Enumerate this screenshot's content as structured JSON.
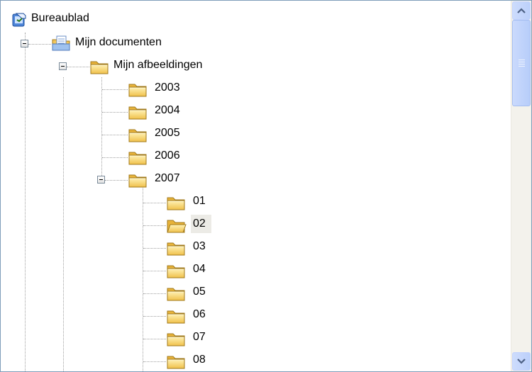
{
  "tree": {
    "root": {
      "label": "Bureaublad",
      "icon": "desktop-icon"
    },
    "documents": {
      "label": "Mijn documenten",
      "icon": "my-documents-icon",
      "expanded": true
    },
    "pictures": {
      "label": "Mijn afbeeldingen",
      "icon": "folder-icon",
      "expanded": true
    },
    "years": [
      {
        "label": "2003",
        "icon": "folder-icon"
      },
      {
        "label": "2004",
        "icon": "folder-icon"
      },
      {
        "label": "2005",
        "icon": "folder-icon"
      },
      {
        "label": "2006",
        "icon": "folder-icon"
      },
      {
        "label": "2007",
        "icon": "folder-icon",
        "expanded": true
      }
    ],
    "months": [
      {
        "label": "01",
        "icon": "folder-icon"
      },
      {
        "label": "02",
        "icon": "open-folder-icon",
        "selected": true
      },
      {
        "label": "03",
        "icon": "folder-icon"
      },
      {
        "label": "04",
        "icon": "folder-icon"
      },
      {
        "label": "05",
        "icon": "folder-icon"
      },
      {
        "label": "06",
        "icon": "folder-icon"
      },
      {
        "label": "07",
        "icon": "folder-icon"
      },
      {
        "label": "08",
        "icon": "folder-icon"
      }
    ]
  },
  "scrollbar": {
    "up_icon": "arrow-up-icon",
    "down_icon": "arrow-down-icon"
  },
  "colors": {
    "folder": "#f3c84b",
    "selection": "#ecebe6",
    "border": "#7f9db9"
  }
}
